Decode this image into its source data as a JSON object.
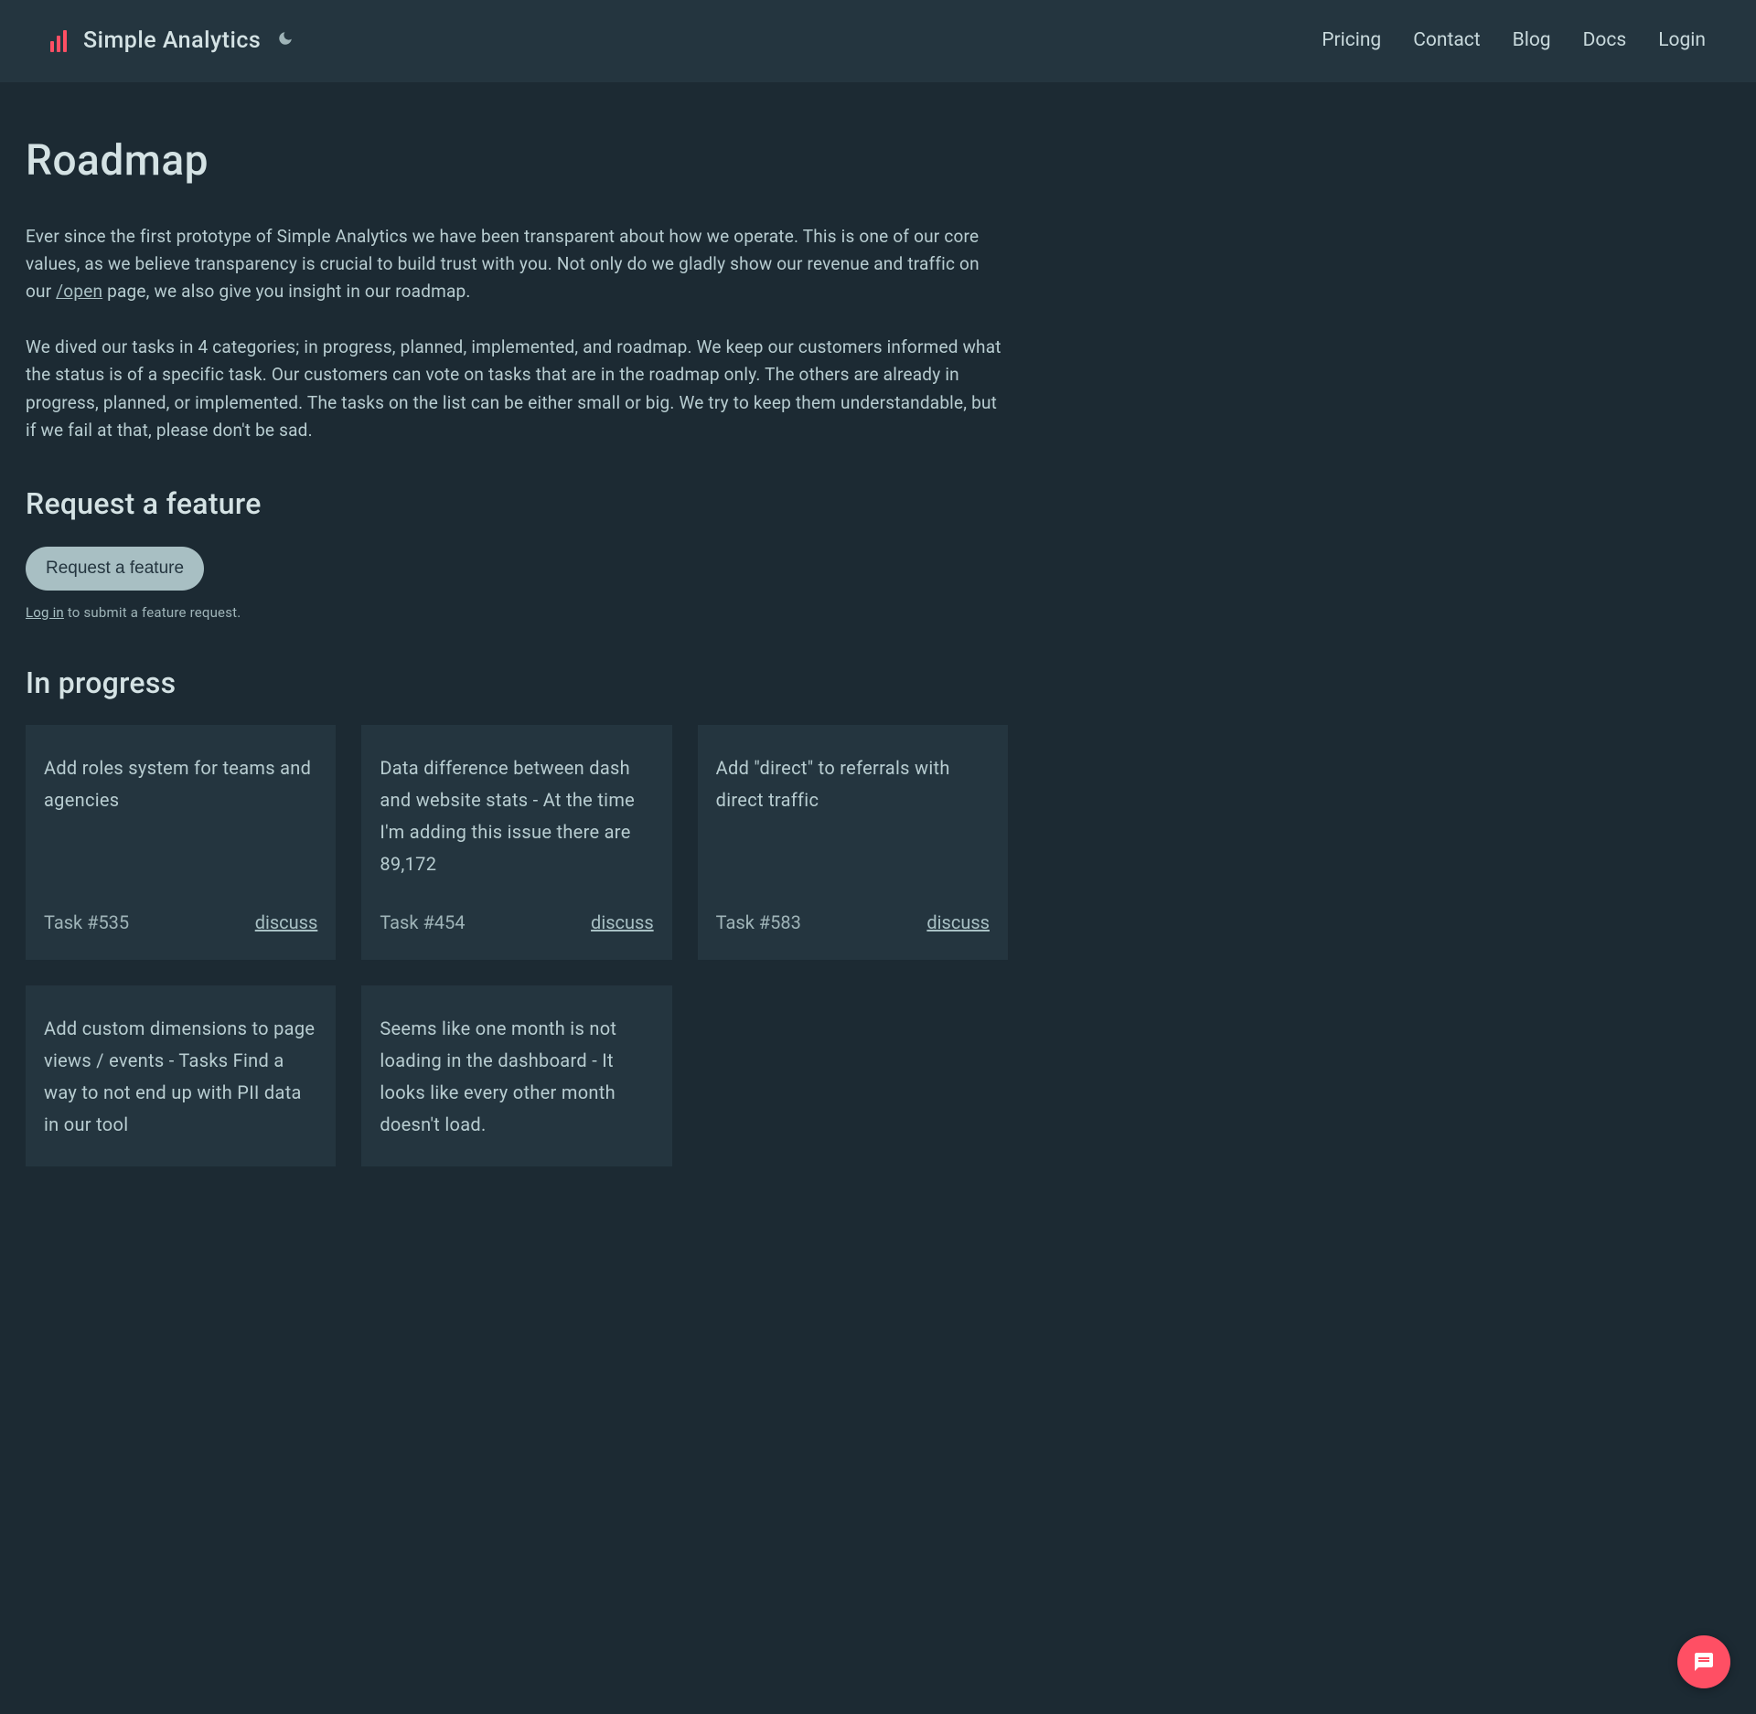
{
  "header": {
    "brand": "Simple Analytics",
    "nav": {
      "pricing": "Pricing",
      "contact": "Contact",
      "blog": "Blog",
      "docs": "Docs",
      "login": "Login"
    }
  },
  "page": {
    "title": "Roadmap",
    "intro_part1": "Ever since the first prototype of Simple Analytics we have been transparent about how we operate. This is one of our core values, as we believe transparency is crucial to build trust with you. Not only do we gladly show our revenue and traffic on our ",
    "open_link": "/open",
    "intro_part2": " page, we also give you insight in our roadmap.",
    "para2": "We dived our tasks in 4 categories; in progress, planned, implemented, and roadmap. We keep our customers informed what the status is of a specific task. Our customers can vote on tasks that are in the roadmap only. The others are already in progress, planned, or implemented. The tasks on the list can be either small or big. We try to keep them understandable, but if we fail at that, please don't be sad."
  },
  "request": {
    "heading": "Request a feature",
    "button": "Request a feature",
    "login_link": "Log in",
    "login_suffix": " to submit a feature request."
  },
  "progress": {
    "heading": "In progress",
    "discuss_label": "discuss",
    "tasks": [
      {
        "title": "Add roles system for teams and agencies",
        "id": "Task #535"
      },
      {
        "title": "Data difference between dash and website stats - At the time I'm adding this issue there are 89,172",
        "id": "Task #454"
      },
      {
        "title": "Add \"direct\" to referrals with direct traffic",
        "id": "Task #583"
      },
      {
        "title": "Add custom dimensions to page views / events - Tasks Find a way to not end up with PII data in our tool",
        "id": ""
      },
      {
        "title": "Seems like one month is not loading in the dashboard - It looks like every other month doesn't load.",
        "id": ""
      }
    ]
  }
}
